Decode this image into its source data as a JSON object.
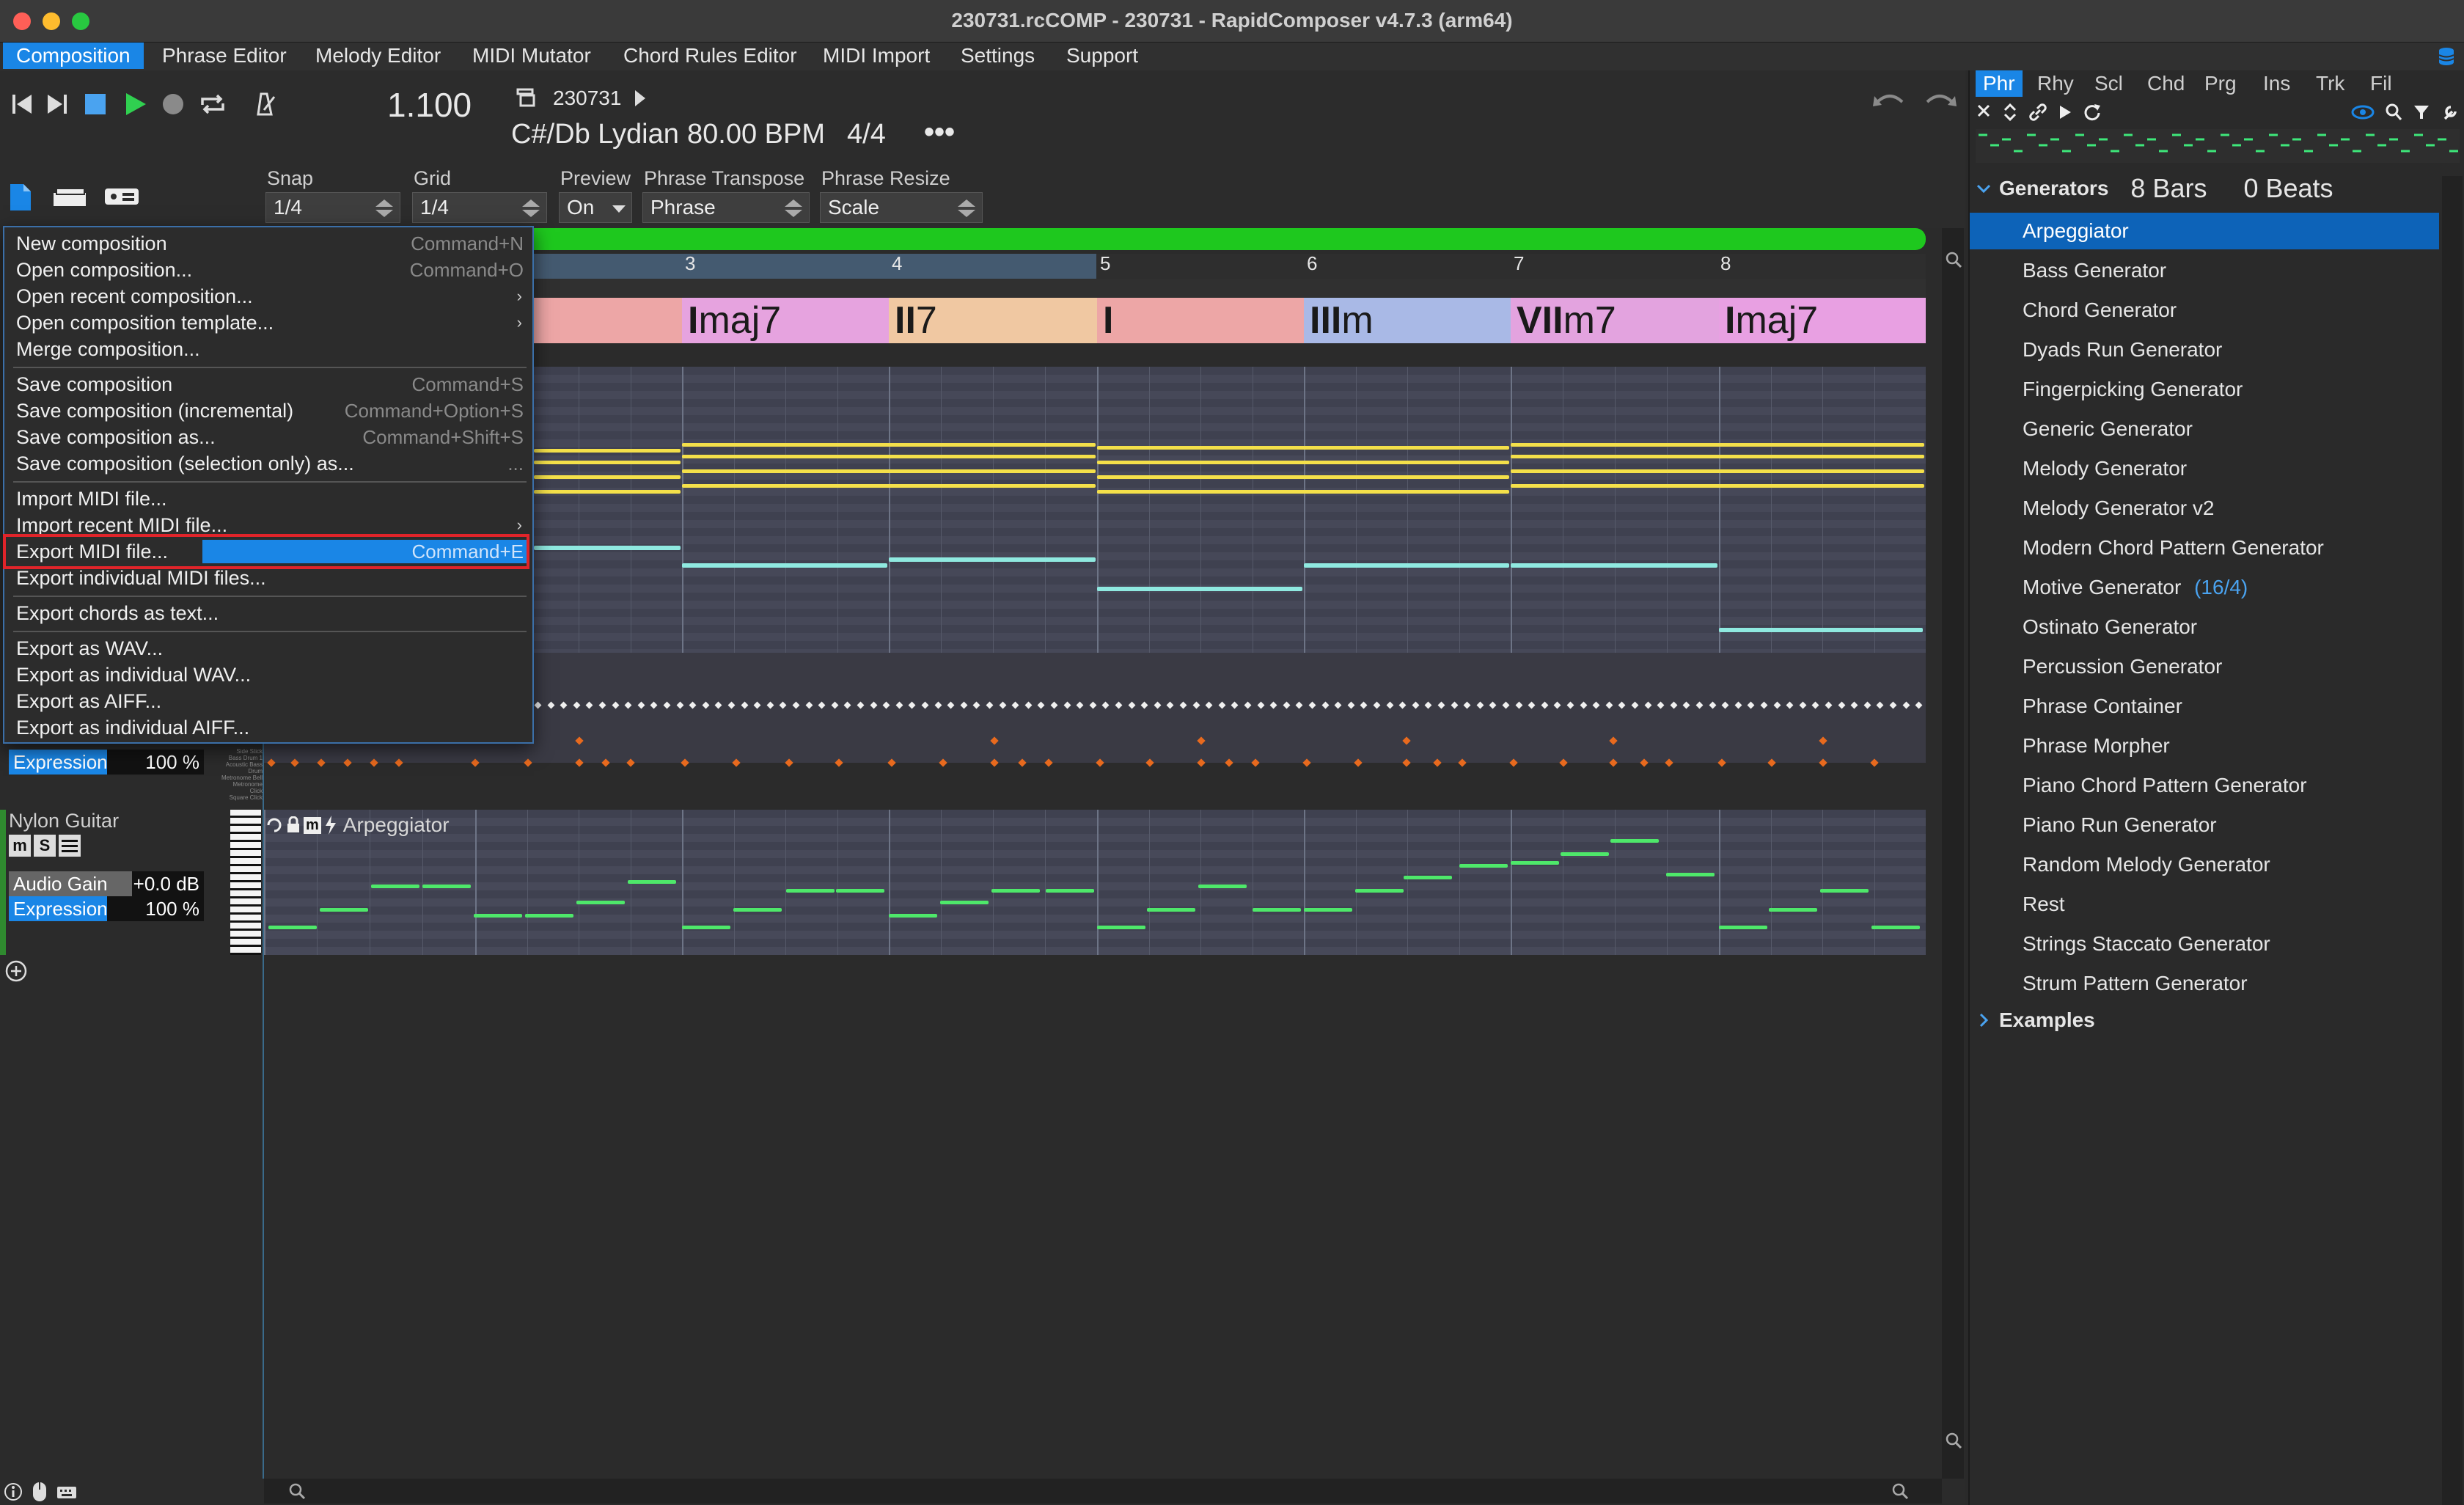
{
  "window": {
    "title": "230731.rcCOMP - 230731 - RapidComposer v4.7.3 (arm64)"
  },
  "menubar": {
    "items": [
      "Composition",
      "Phrase Editor",
      "Melody Editor",
      "MIDI Mutator",
      "Chord Rules Editor",
      "MIDI Import",
      "Settings",
      "Support"
    ],
    "active": "Composition"
  },
  "transport": {
    "position": "1.100",
    "composition_name": "230731",
    "key_info": "C#/Db Lydian",
    "tempo": "80.00 BPM",
    "meter": "4/4",
    "more": "•••"
  },
  "controls": {
    "snap_label": "Snap",
    "snap_value": "1/4",
    "grid_label": "Grid",
    "grid_value": "1/4",
    "preview_label": "Preview",
    "preview_value": "On",
    "phrase_transpose_label": "Phrase Transpose",
    "phrase_transpose_value": "Phrase",
    "phrase_resize_label": "Phrase Resize",
    "phrase_resize_value": "Scale"
  },
  "ruler": {
    "bars": [
      "3",
      "4",
      "5",
      "6",
      "7",
      "8"
    ]
  },
  "chords": [
    {
      "roman": "I",
      "suffix": "maj7",
      "color": "#e6a3df"
    },
    {
      "roman": "II",
      "suffix": "7",
      "color": "#f0c8a2"
    },
    {
      "roman": "I",
      "suffix": "",
      "color": "#eda6a6"
    },
    {
      "roman": "III",
      "suffix": "m",
      "color": "#a9b9e6"
    },
    {
      "roman": "VII",
      "suffix": "m7",
      "color": "#e3a3df"
    },
    {
      "roman": "I",
      "suffix": "maj7",
      "color": "#e8a0e2"
    }
  ],
  "file_menu": {
    "items": [
      {
        "label": "New composition",
        "shortcut": "Command+N"
      },
      {
        "label": "Open composition...",
        "shortcut": "Command+O"
      },
      {
        "label": "Open recent composition...",
        "submenu": "›"
      },
      {
        "label": "Open composition template...",
        "submenu": "›"
      },
      {
        "label": "Merge composition..."
      },
      {
        "label": "Save composition",
        "shortcut": "Command+S"
      },
      {
        "label": "Save composition (incremental)",
        "shortcut": "Command+Option+S"
      },
      {
        "label": "Save composition as...",
        "shortcut": "Command+Shift+S"
      },
      {
        "label": "Save composition (selection only) as...",
        "shortcut": "..."
      },
      {
        "label": "Import MIDI file..."
      },
      {
        "label": "Import recent MIDI file...",
        "submenu": "›"
      },
      {
        "label": "Export MIDI file...",
        "shortcut": "Command+E"
      },
      {
        "label": "Export individual MIDI files..."
      },
      {
        "label": "Export chords as text..."
      },
      {
        "label": "Export as WAV..."
      },
      {
        "label": "Export as individual WAV..."
      },
      {
        "label": "Export as AIFF..."
      },
      {
        "label": "Export as individual AIFF..."
      }
    ]
  },
  "tracks": [
    {
      "name": "",
      "expression_label": "Expression",
      "expression_value": "100 %"
    },
    {
      "name": "Nylon Guitar",
      "audio_gain_label": "Audio Gain",
      "audio_gain_value": "+0.0 dB",
      "expression_label": "Expression",
      "expression_value": "100 %",
      "phrase_label": "Arpeggiator"
    }
  ],
  "drum_labels": [
    "Side Stick",
    "Bass Drum 1",
    "Acoustic Bass Drum",
    "Metronome Bell",
    "Metronome Click",
    "Square Click"
  ],
  "right_panel": {
    "tabs": [
      "Phr",
      "Rhy",
      "Scl",
      "Chd",
      "Prg",
      "Ins",
      "Trk",
      "Fil"
    ],
    "active_tab": "Phr",
    "generators_label": "Generators",
    "length_bars": "8 Bars",
    "length_beats": "0 Beats",
    "generators": [
      "Arpeggiator",
      "Bass Generator",
      "Chord Generator",
      "Dyads Run Generator",
      "Fingerpicking Generator",
      "Generic Generator",
      "Melody Generator",
      "Melody Generator v2",
      "Modern Chord Pattern Generator",
      "Motive Generator",
      "Ostinato Generator",
      "Percussion Generator",
      "Phrase Container",
      "Phrase Morpher",
      "Piano Chord Pattern Generator",
      "Piano Run Generator",
      "Random Melody Generator",
      "Rest",
      "Strings Staccato Generator",
      "Strum Pattern Generator"
    ],
    "motive_suffix": "(16/4)",
    "selected": "Arpeggiator",
    "examples_label": "Examples"
  },
  "colors": {
    "accent": "#1a86e6",
    "progress": "#1ec81e",
    "highlight_box": "#e0242a",
    "note_yellow": "#f4e04a",
    "note_cyan": "#8fe9e0",
    "note_green": "#4ee86a",
    "drum_orange": "#e86a1e"
  }
}
